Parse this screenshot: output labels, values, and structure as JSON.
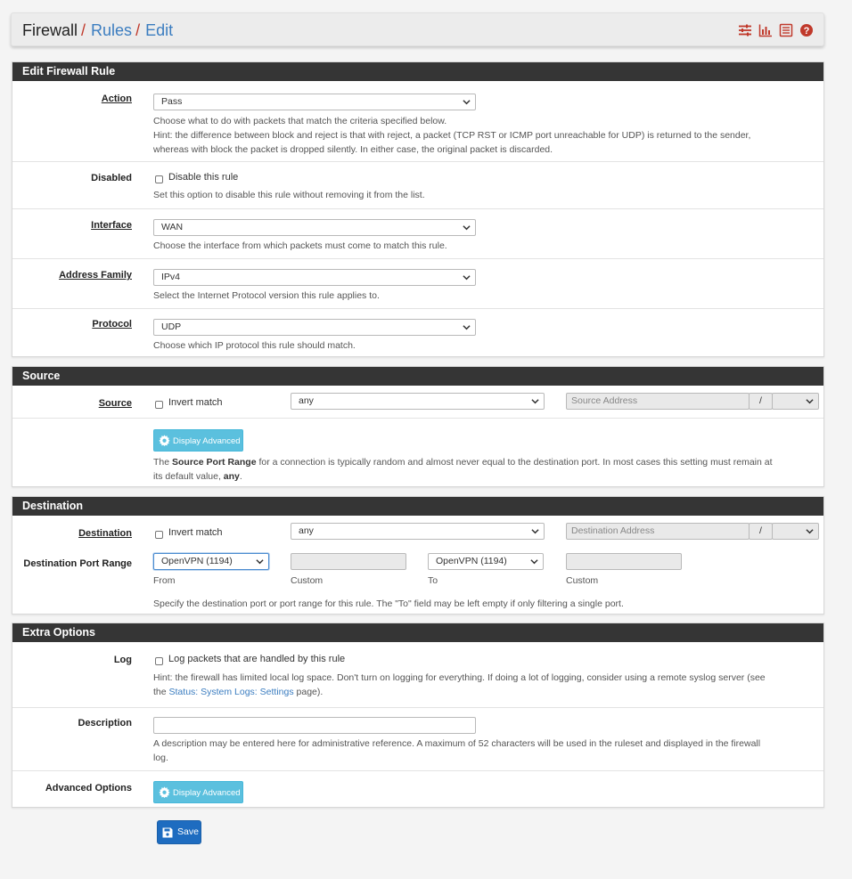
{
  "breadcrumb": {
    "root": "Firewall",
    "rules": "Rules",
    "edit": "Edit"
  },
  "header_icons": [
    "sliders-icon",
    "bar-chart-icon",
    "list-icon",
    "help-icon"
  ],
  "accent_color": "#c0392b",
  "link_color": "#3b7dc0",
  "edit_rule": {
    "title": "Edit Firewall Rule",
    "action": {
      "label": "Action",
      "value": "Pass",
      "help1": "Choose what to do with packets that match the criteria specified below.",
      "help2": "Hint: the difference between block and reject is that with reject, a packet (TCP RST or ICMP port unreachable for UDP) is returned to the sender,",
      "help3": "whereas with block the packet is dropped silently. In either case, the original packet is discarded."
    },
    "disabled": {
      "label": "Disabled",
      "checkbox": "Disable this rule",
      "help": "Set this option to disable this rule without removing it from the list."
    },
    "interface": {
      "label": "Interface",
      "value": "WAN",
      "help": "Choose the interface from which packets must come to match this rule."
    },
    "family": {
      "label": "Address Family",
      "value": "IPv4",
      "help": "Select the Internet Protocol version this rule applies to."
    },
    "protocol": {
      "label": "Protocol",
      "value": "UDP",
      "help": "Choose which IP protocol this rule should match."
    }
  },
  "source": {
    "title": "Source",
    "label": "Source",
    "invert": "Invert match",
    "type": "any",
    "address_placeholder": "Source Address",
    "slash": "/",
    "adv_button": "Display Advanced",
    "help_pre": "The ",
    "help_bold": "Source Port Range",
    "help_mid": " for a connection is typically random and almost never equal to the destination port. In most cases this setting must remain at",
    "help_line2_pre": "its default value, ",
    "help_line2_bold": "any",
    "help_line2_end": "."
  },
  "destination": {
    "title": "Destination",
    "label": "Destination",
    "invert": "Invert match",
    "type": "any",
    "address_placeholder": "Destination Address",
    "slash": "/",
    "port_label": "Destination Port Range",
    "from_value": "OpenVPN (1194)",
    "to_value": "OpenVPN (1194)",
    "from_label": "From",
    "custom_label": "Custom",
    "to_label": "To",
    "custom_label2": "Custom",
    "port_help": "Specify the destination port or port range for this rule. The \"To\" field may be left empty if only filtering a single port."
  },
  "extra": {
    "title": "Extra Options",
    "log": {
      "label": "Log",
      "checkbox": "Log packets that are handled by this rule",
      "help1": "Hint: the firewall has limited local log space. Don't turn on logging for everything. If doing a lot of logging, consider using a remote syslog server (see",
      "help2_pre": "the ",
      "help2_link": "Status: System Logs: Settings",
      "help2_end": " page)."
    },
    "description": {
      "label": "Description",
      "help1": "A description may be entered here for administrative reference. A maximum of 52 characters will be used in the ruleset and displayed in the firewall",
      "help2": "log."
    },
    "advanced": {
      "label": "Advanced Options",
      "button": "Display Advanced"
    }
  },
  "save_button": "Save"
}
